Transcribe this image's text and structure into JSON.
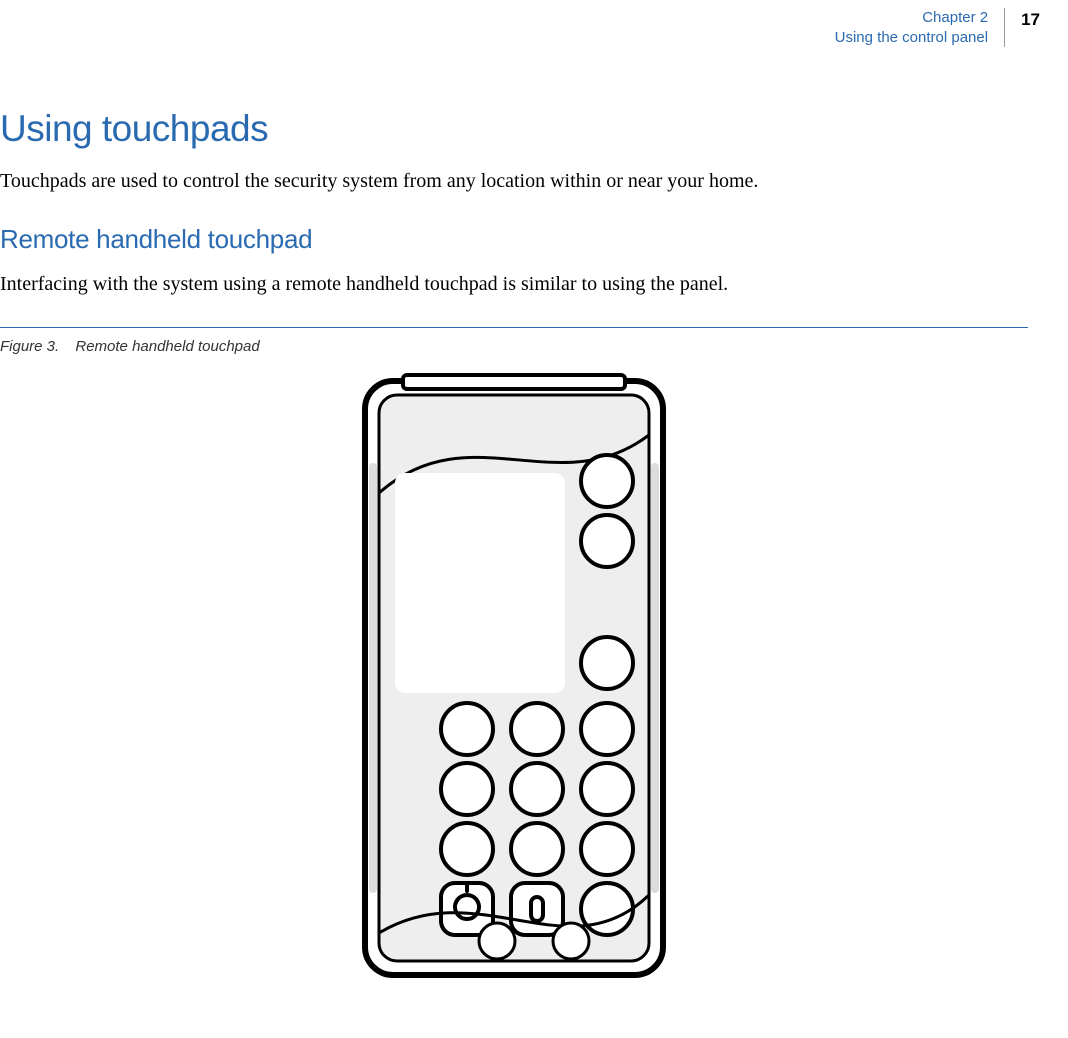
{
  "header": {
    "chapter": "Chapter 2",
    "title": "Using the control panel",
    "page": "17"
  },
  "section": {
    "heading": "Using touchpads",
    "intro": "Touchpads are used to control the security system from any location within or near your home."
  },
  "subsection": {
    "heading": "Remote handheld touchpad",
    "intro": "Interfacing with the system using a remote handheld touchpad is similar to using the panel."
  },
  "figure": {
    "label": "Figure 3.",
    "caption": "Remote handheld touchpad"
  }
}
